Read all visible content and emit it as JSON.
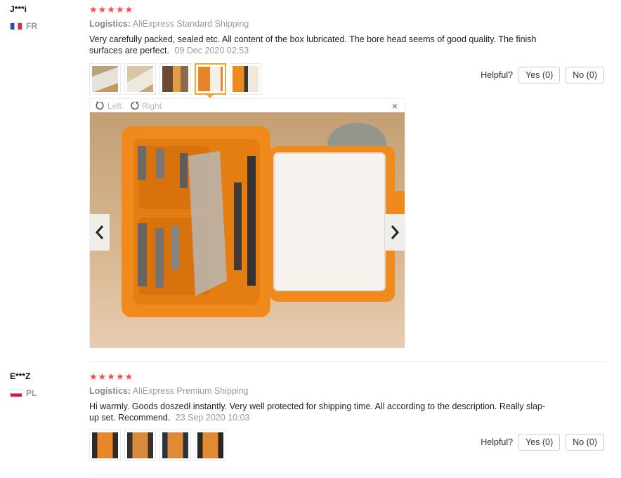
{
  "reviews": [
    {
      "user": "J***i",
      "country": "FR",
      "stars": "★★★★★",
      "logistics_label": "Logistics:",
      "logistics_value": "AliExpress Standard Shipping",
      "text": "Very carefully packed, sealed etc. All content of the box lubricated. The bore head seems of good quality. The finish surfaces are perfect.",
      "date": "09 Dec 2020 02:53",
      "helpful_label": "Helpful?",
      "yes_label": "Yes (0)",
      "no_label": "No (0)"
    },
    {
      "user": "E***Z",
      "country": "PL",
      "stars": "★★★★★",
      "logistics_label": "Logistics:",
      "logistics_value": "AliExpress Premium Shipping",
      "text": "Hi warmly. Goods doszedł instantly. Very well protected for shipping time. All according to the description. Really slap-up set. Recommend.",
      "date": "23 Sep 2020 10:03",
      "helpful_label": "Helpful?",
      "yes_label": "Yes (0)",
      "no_label": "No (0)"
    }
  ],
  "viewer": {
    "rotate_left": "Left",
    "rotate_right": "Right",
    "close": "×",
    "prev": "‹",
    "next": "›"
  },
  "colors": {
    "star": "#f54d4d",
    "accent": "#f5a623",
    "case_orange": "#f08a1c"
  }
}
